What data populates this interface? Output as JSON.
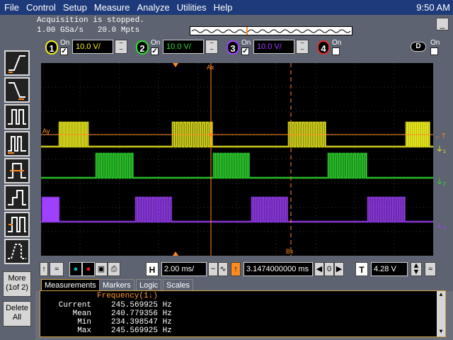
{
  "menu": [
    "File",
    "Control",
    "Setup",
    "Measure",
    "Analyze",
    "Utilities",
    "Help"
  ],
  "clock": "9:50 AM",
  "status": {
    "message": "Acquisition is stopped.",
    "rate": "1.00 GSa/s   20.0 Mpts",
    "minimize": "_"
  },
  "channels": [
    {
      "num": "1",
      "on": "On",
      "scale": "10.0 V/",
      "color": "#f0f020"
    },
    {
      "num": "2",
      "on": "On",
      "scale": "10.0 V/",
      "color": "#30e030"
    },
    {
      "num": "3",
      "on": "On",
      "scale": "10.0 V/",
      "color": "#a040ff"
    },
    {
      "num": "4",
      "on": "On",
      "scale": "",
      "color": "#e03030"
    }
  ],
  "digital": {
    "label": "D",
    "on": "On"
  },
  "left_tools": {
    "more": "More\n(1of 2)",
    "delete": "Delete\nAll"
  },
  "display": {
    "marker_ax": "Ax",
    "marker_bx": "Bx",
    "marker_ay": "Ay",
    "trigger_label": "T",
    "trace_labels": [
      "1",
      "2",
      "3"
    ]
  },
  "horizontal": {
    "h_label": "H",
    "timebase": "2.00 ms/",
    "delay": "3.1474000000 ms",
    "delay_step": "0",
    "t_label": "T",
    "trigger_level": "4.28 V"
  },
  "tabs": [
    "Measurements",
    "Markers",
    "Logic",
    "Scales"
  ],
  "measurements": {
    "title": "Frequency(1↓)",
    "rows": [
      {
        "label": "Current",
        "value": "245.569925 Hz"
      },
      {
        "label": "Mean",
        "value": "240.779356 Hz"
      },
      {
        "label": "Min",
        "value": "234.398547 Hz"
      },
      {
        "label": "Max",
        "value": "245.569925 Hz"
      }
    ]
  },
  "colors": {
    "marker": "#ff8a20",
    "ch1": "#f0f020",
    "ch2": "#30e030",
    "ch3": "#a040ff"
  }
}
